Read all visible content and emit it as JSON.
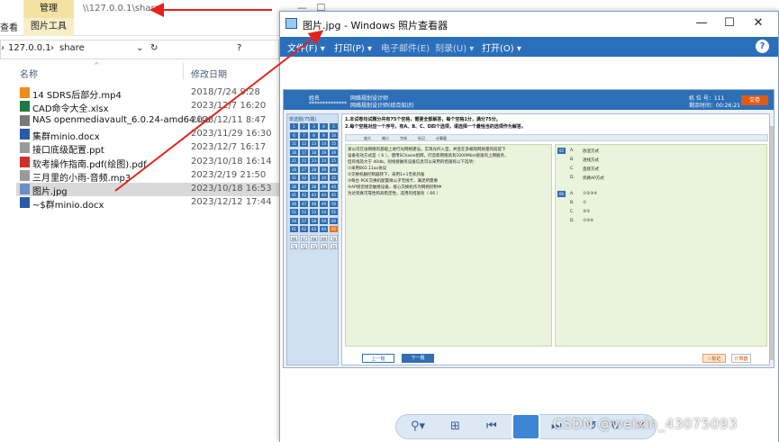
{
  "explorer": {
    "ribbon": {
      "manage_tab": "管理",
      "picture_tools_tab": "图片工具",
      "view_tab": "查看",
      "title_path": "\\\\127.0.0.1\\share"
    },
    "address": {
      "segments": [
        "127.0.0.1",
        "share"
      ]
    },
    "columns": {
      "name": "名称",
      "date": "修改日期"
    },
    "files": [
      {
        "name": "14 SDRS后部分.mp4",
        "date": "2018/7/24 9:28",
        "icon": "vlc-icon",
        "color": "#f08c1a"
      },
      {
        "name": "CAD命令大全.xlsx",
        "date": "2023/12/7 16:20",
        "icon": "excel-icon",
        "color": "#1d7a43"
      },
      {
        "name": "NAS openmediavault_6.0.24-amd64.iso",
        "date": "2023/12/11 8:47",
        "icon": "disc-icon",
        "color": "#7a7a7a"
      },
      {
        "name": "集群minio.docx",
        "date": "2023/11/29 16:30",
        "icon": "word-icon",
        "color": "#2a5ba8"
      },
      {
        "name": "接口底级配置.ppt",
        "date": "2023/12/7 16:17",
        "icon": "doc-icon",
        "color": "#9a9a9a"
      },
      {
        "name": "软考操作指南.pdf(绘图).pdf",
        "date": "2023/10/18 16:14",
        "icon": "pdf-icon",
        "color": "#d0302b"
      },
      {
        "name": "三月里的小雨-音频.mp3",
        "date": "2023/2/19 21:50",
        "icon": "audio-icon",
        "color": "#9a9a9a"
      },
      {
        "name": "图片.jpg",
        "date": "2023/10/18 16:53",
        "icon": "image-icon",
        "color": "#6b8fc4",
        "selected": true
      },
      {
        "name": "~$群minio.docx",
        "date": "2023/12/12 17:44",
        "icon": "word-icon",
        "color": "#2a5ba8"
      }
    ]
  },
  "viewer": {
    "title": "图片.jpg - Windows 照片查看器",
    "menu": [
      {
        "label": "文件(F) ▾",
        "dim": false
      },
      {
        "label": "打印(P) ▾",
        "dim": false
      },
      {
        "label": "电子邮件(E)",
        "dim": true
      },
      {
        "label": "刻录(U) ▾",
        "dim": true
      },
      {
        "label": "打开(O) ▾",
        "dim": false
      }
    ],
    "help": "?",
    "controls": {
      "zoom": "⚲▾",
      "fit": "⊞",
      "prev": "⏮",
      "next": "⏭",
      "rotate_ccw": "↺",
      "rotate_cw": "↻",
      "delete": "✕"
    }
  },
  "exam": {
    "header": {
      "name_label": "姓名",
      "exam_title_1": "网络规划设计师",
      "exam_title_2": "网络规划设计师(综合知识)",
      "seat": "机 位 号：111",
      "time": "剩余时间：00:26:21",
      "submit": "交卷"
    },
    "sidebar_caption": "单选题(75题)",
    "instructions": [
      "1.本试卷均试题分共有75个空格，需要全部解答，每个空格1分，满分75分。",
      "2.每个空格对应一个序号，有A、B、C、D四个选项，请选择一个最恰当的选项作为解答。"
    ],
    "tools": [
      "放大",
      "缩小",
      "字体",
      "标记",
      "计算器"
    ],
    "stem": [
      "某公司在张网络的基础上进行光网络建设。实现光纤入室，并且在多端现网质量的前提下",
      "设备有效方式是（ 6 ）。使用SChasie组网，打造新网络具有1000Mb/s接速的上网服务，",
      "但有线及大于 40db。则线接触有设备信息可以采用的措施有以下选项：",
      "①采用802.11ax协议",
      "②交换机删控制器转下，采用1+1无机热备",
      "③每台 POE交换机配置样公子无线卡，满足所需要",
      "④AP接近接近触接设备，接心交换机作为网络控制中",
      "为达到真可靠性和高稳定性，选用的措施有（ 66 ）"
    ],
    "options": [
      {
        "badge": "65",
        "letter": "A.",
        "text": "放混方式"
      },
      {
        "badge": "",
        "letter": "B.",
        "text": "透线方式"
      },
      {
        "badge": "",
        "letter": "C.",
        "text": "直接方式"
      },
      {
        "badge": "",
        "letter": "D.",
        "text": "旁路AP方式"
      },
      {
        "badge": "66",
        "letter": "A.",
        "text": "①②③④"
      },
      {
        "badge": "",
        "letter": "B.",
        "text": "①"
      },
      {
        "badge": "",
        "letter": "C.",
        "text": "②③"
      },
      {
        "badge": "",
        "letter": "D.",
        "text": "①③④"
      }
    ],
    "footer": {
      "prev": "上一题",
      "next": "下一题",
      "mark": "☆标记",
      "calc": "计算器"
    }
  },
  "watermark": "CSDN @weixin_43075093",
  "colors": {
    "accent": "#2b6fba",
    "arrow": "#e2231a"
  }
}
